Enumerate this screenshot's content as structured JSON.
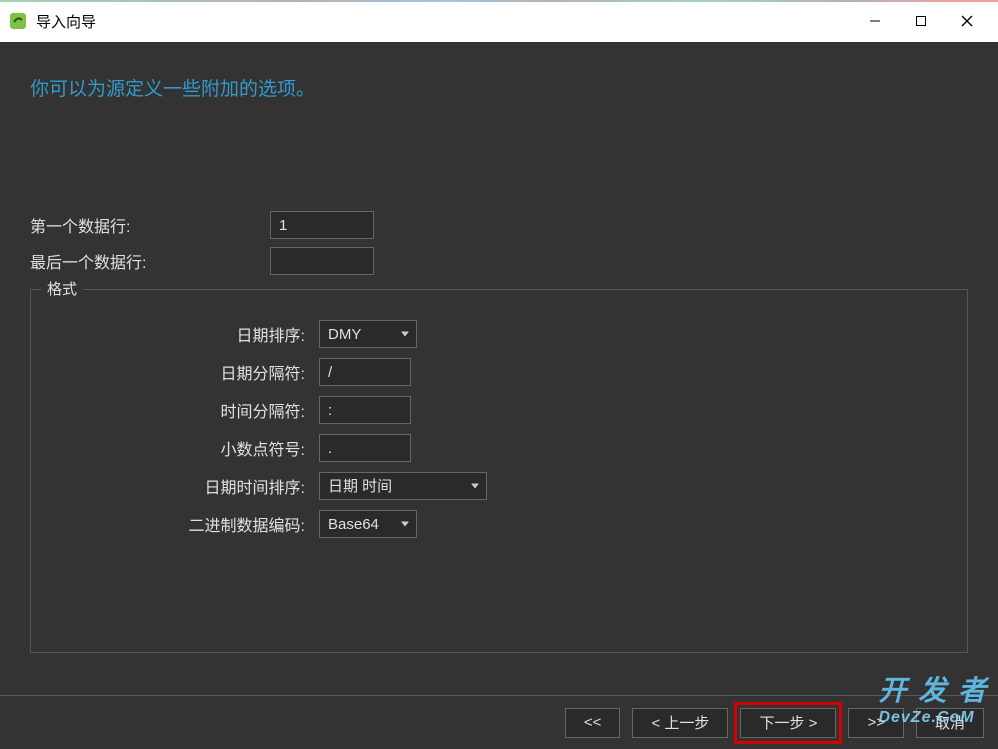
{
  "titlebar": {
    "title": "导入向导"
  },
  "subtitle": "你可以为源定义一些附加的选项。",
  "form": {
    "first_data_row_label": "第一个数据行:",
    "first_data_row_value": "1",
    "last_data_row_label": "最后一个数据行:",
    "last_data_row_value": ""
  },
  "format": {
    "legend": "格式",
    "date_order_label": "日期排序:",
    "date_order_value": "DMY",
    "date_sep_label": "日期分隔符:",
    "date_sep_value": "/",
    "time_sep_label": "时间分隔符:",
    "time_sep_value": ":",
    "decimal_label": "小数点符号:",
    "decimal_value": ".",
    "datetime_order_label": "日期时间排序:",
    "datetime_order_value": "日期 时间",
    "binary_label": "二进制数据编码:",
    "binary_value": "Base64"
  },
  "footer": {
    "first": "<<",
    "prev": "< 上一步",
    "next": "下一步 >",
    "last": ">>",
    "cancel": "取消"
  },
  "watermark": {
    "line1": "开 发 者",
    "line2": "DevZe.CoM"
  }
}
